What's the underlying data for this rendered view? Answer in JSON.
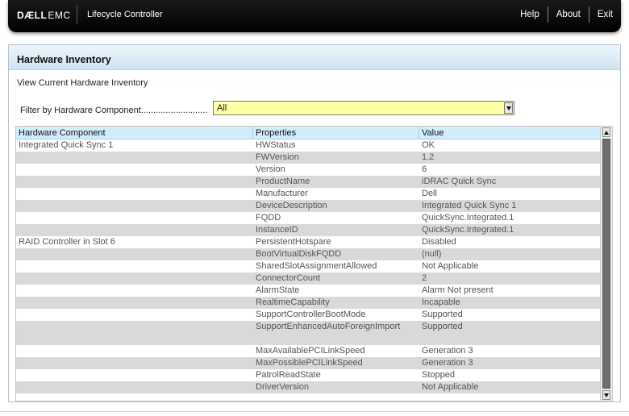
{
  "header": {
    "brand_dell": "DÆLL",
    "brand_emc": "EMC",
    "product": "Lifecycle Controller",
    "links": {
      "help": "Help",
      "about": "About",
      "exit": "Exit"
    }
  },
  "panel": {
    "title": "Hardware Inventory",
    "subtitle": "View Current Hardware Inventory"
  },
  "filter": {
    "label": "Filter by Hardware Component...........................",
    "selected": "All"
  },
  "table": {
    "columns": [
      "Hardware Component",
      "Properties",
      "Value"
    ],
    "rows": [
      {
        "component": "Integrated Quick Sync 1",
        "property": "HWStatus",
        "value": "OK"
      },
      {
        "component": "",
        "property": "FWVersion",
        "value": "1.2"
      },
      {
        "component": "",
        "property": "Version",
        "value": "6"
      },
      {
        "component": "",
        "property": "ProductName",
        "value": "iDRAC Quick Sync"
      },
      {
        "component": "",
        "property": "Manufacturer",
        "value": "Dell"
      },
      {
        "component": "",
        "property": "DeviceDescription",
        "value": "Integrated Quick Sync 1"
      },
      {
        "component": "",
        "property": "FQDD",
        "value": "QuickSync.Integrated.1"
      },
      {
        "component": "",
        "property": "InstanceID",
        "value": "QuickSync.Integrated.1"
      },
      {
        "component": "RAID Controller in Slot 6",
        "property": "PersistentHotspare",
        "value": "Disabled"
      },
      {
        "component": "",
        "property": "BootVirtualDiskFQDD",
        "value": "(null)"
      },
      {
        "component": "",
        "property": "SharedSlotAssignmentAllowed",
        "value": "Not Applicable"
      },
      {
        "component": "",
        "property": "ConnectorCount",
        "value": "2"
      },
      {
        "component": "",
        "property": "AlarmState",
        "value": "Alarm Not present"
      },
      {
        "component": "",
        "property": "RealtimeCapability",
        "value": "Incapable"
      },
      {
        "component": "",
        "property": "SupportControllerBootMode",
        "value": "Supported"
      },
      {
        "component": "",
        "property": "SupportEnhancedAutoForeignImport",
        "value": "Supported",
        "tall": true
      },
      {
        "component": "",
        "property": "MaxAvailablePCILinkSpeed",
        "value": "Generation 3"
      },
      {
        "component": "",
        "property": "MaxPossiblePCILinkSpeed",
        "value": "Generation 3"
      },
      {
        "component": "",
        "property": "PatrolReadState",
        "value": "Stopped"
      },
      {
        "component": "",
        "property": "DriverVersion",
        "value": "Not Applicable"
      }
    ]
  },
  "colors": {
    "topbar": "#000000",
    "panel_header": "#cfe3f1",
    "table_header": "#d2ecfa",
    "row_alt": "#d9d9d9",
    "select_bg": "#ffffa4"
  }
}
